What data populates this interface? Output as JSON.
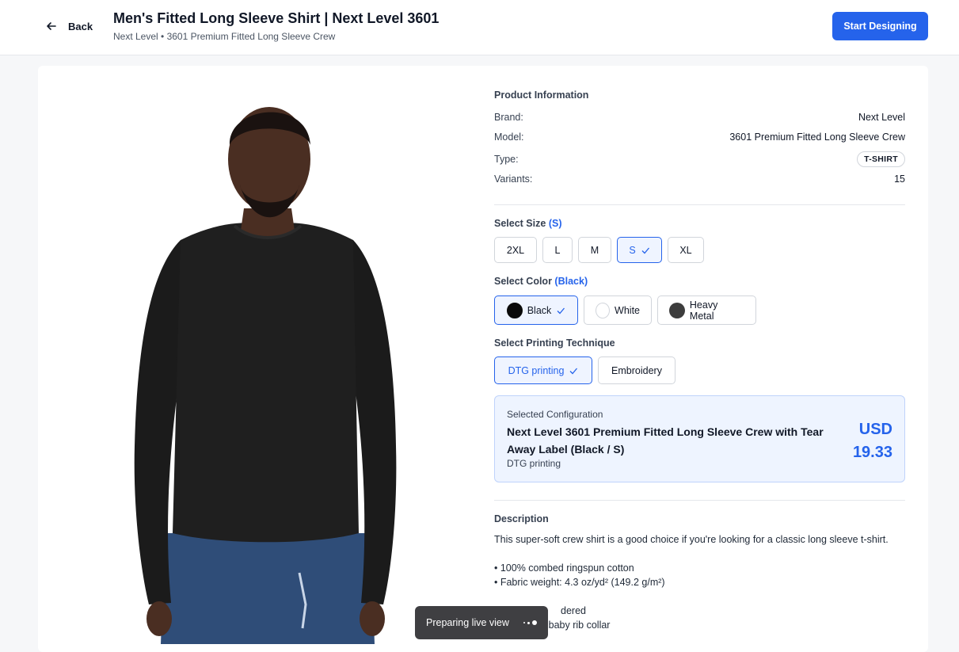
{
  "header": {
    "back_label": "Back",
    "title": "Men's Fitted Long Sleeve Shirt | Next Level 3601",
    "subtitle": "Next Level • 3601 Premium Fitted Long Sleeve Crew",
    "start_button": "Start Designing"
  },
  "product_info": {
    "heading": "Product Information",
    "brand_label": "Brand:",
    "brand_value": "Next Level",
    "model_label": "Model:",
    "model_value": "3601 Premium Fitted Long Sleeve Crew",
    "type_label": "Type:",
    "type_value": "T-SHIRT",
    "variants_label": "Variants:",
    "variants_value": "15"
  },
  "size": {
    "heading": "Select Size",
    "selected": "(S)",
    "options": [
      "2XL",
      "L",
      "M",
      "S",
      "XL"
    ]
  },
  "color": {
    "heading": "Select Color",
    "selected": "(Black)",
    "options": [
      {
        "label": "Black",
        "hex": "#0a0a0a"
      },
      {
        "label": "White",
        "hex": "#ffffff"
      },
      {
        "label": "Heavy Metal",
        "hex": "#3d3d3d"
      }
    ]
  },
  "technique": {
    "heading": "Select Printing Technique",
    "options": [
      "DTG printing",
      "Embroidery"
    ]
  },
  "configuration": {
    "label": "Selected Configuration",
    "name": "Next Level 3601 Premium Fitted Long Sleeve Crew with Tear Away Label (Black / S)",
    "technique": "DTG printing",
    "currency": "USD",
    "price": "19.33"
  },
  "description": {
    "heading": "Description",
    "intro": "This super-soft crew shirt is a good choice if you're looking for a classic long sleeve t-shirt.",
    "bullets": [
      "• 100% combed ringspun cotton",
      "• Fabric weight: 4.3 oz/yd² (149.2 g/m²)",
      "• Set-in 1×1 baby rib collar"
    ],
    "partial_line": "dered"
  },
  "toast": {
    "text": "Preparing live view"
  },
  "colors": {
    "accent": "#2563eb",
    "shirt": "#1b1b1b",
    "jeans": "#2f4d78",
    "skin": "#4a2e22"
  }
}
